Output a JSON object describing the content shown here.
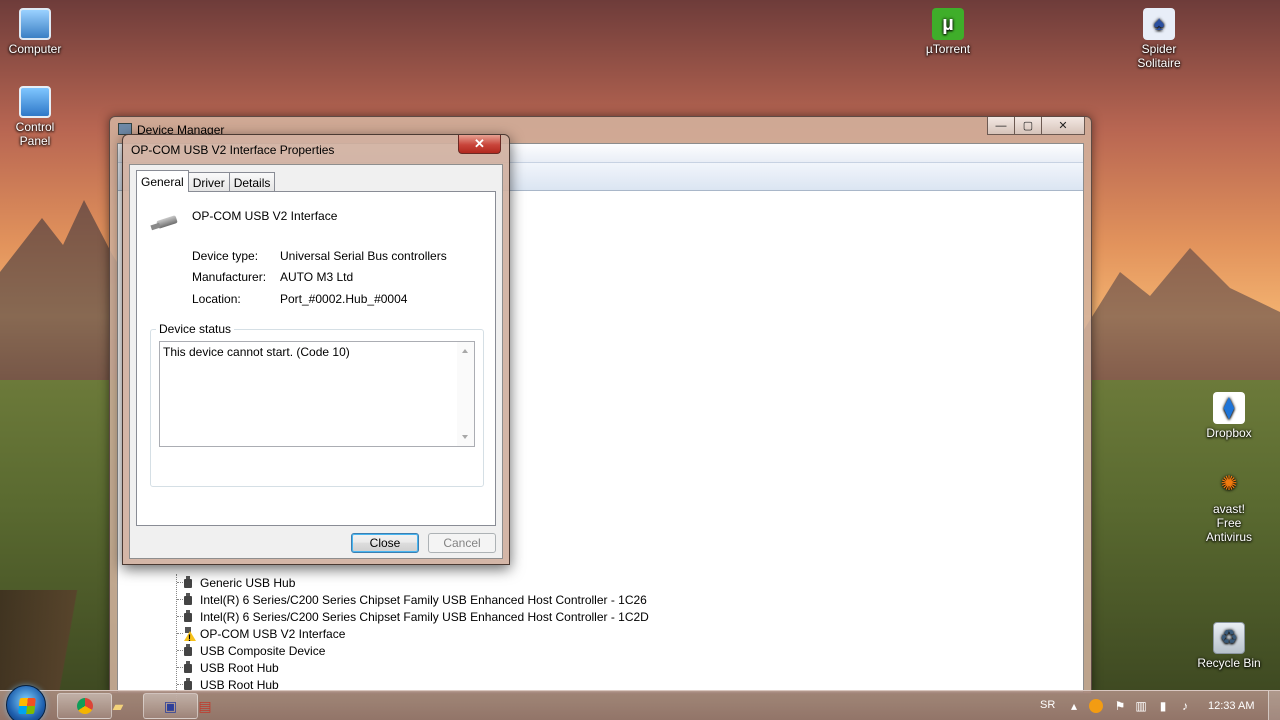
{
  "desktop": {
    "icons": [
      {
        "label": "Computer"
      },
      {
        "label": "Control Panel"
      },
      {
        "label": "µTorrent"
      },
      {
        "label": "Spider Solitaire"
      },
      {
        "label": "Dropbox"
      },
      {
        "label": "avast! Free Antivirus"
      },
      {
        "label": "Recycle Bin"
      }
    ]
  },
  "device_manager": {
    "title": "Device Manager",
    "window_buttons": {
      "minimize": "—",
      "maximize": "▢",
      "close": "✕"
    },
    "tree_items": [
      {
        "label": "Generic USB Hub",
        "warning": false
      },
      {
        "label": "Intel(R) 6 Series/C200 Series Chipset Family USB Enhanced Host Controller - 1C26",
        "warning": false
      },
      {
        "label": "Intel(R) 6 Series/C200 Series Chipset Family USB Enhanced Host Controller - 1C2D",
        "warning": false
      },
      {
        "label": "OP-COM USB V2 Interface",
        "warning": true
      },
      {
        "label": "USB Composite Device",
        "warning": false
      },
      {
        "label": "USB Root Hub",
        "warning": false
      },
      {
        "label": "USB Root Hub",
        "warning": false
      }
    ]
  },
  "properties_dialog": {
    "title": "OP-COM USB V2 Interface Properties",
    "close_glyph": "✕",
    "tabs": [
      {
        "label": "General",
        "active": true
      },
      {
        "label": "Driver",
        "active": false
      },
      {
        "label": "Details",
        "active": false
      }
    ],
    "device_name": "OP-COM USB V2 Interface",
    "fields": [
      {
        "label": "Device type:",
        "value": "Universal Serial Bus controllers"
      },
      {
        "label": "Manufacturer:",
        "value": "AUTO M3 Ltd"
      },
      {
        "label": "Location:",
        "value": "Port_#0002.Hub_#0004"
      }
    ],
    "device_status_label": "Device status",
    "device_status_text": "This device cannot start. (Code 10)",
    "buttons": {
      "close": "Close",
      "cancel": "Cancel"
    }
  },
  "taskbar": {
    "language": "SR",
    "clock": "12:33 AM"
  }
}
